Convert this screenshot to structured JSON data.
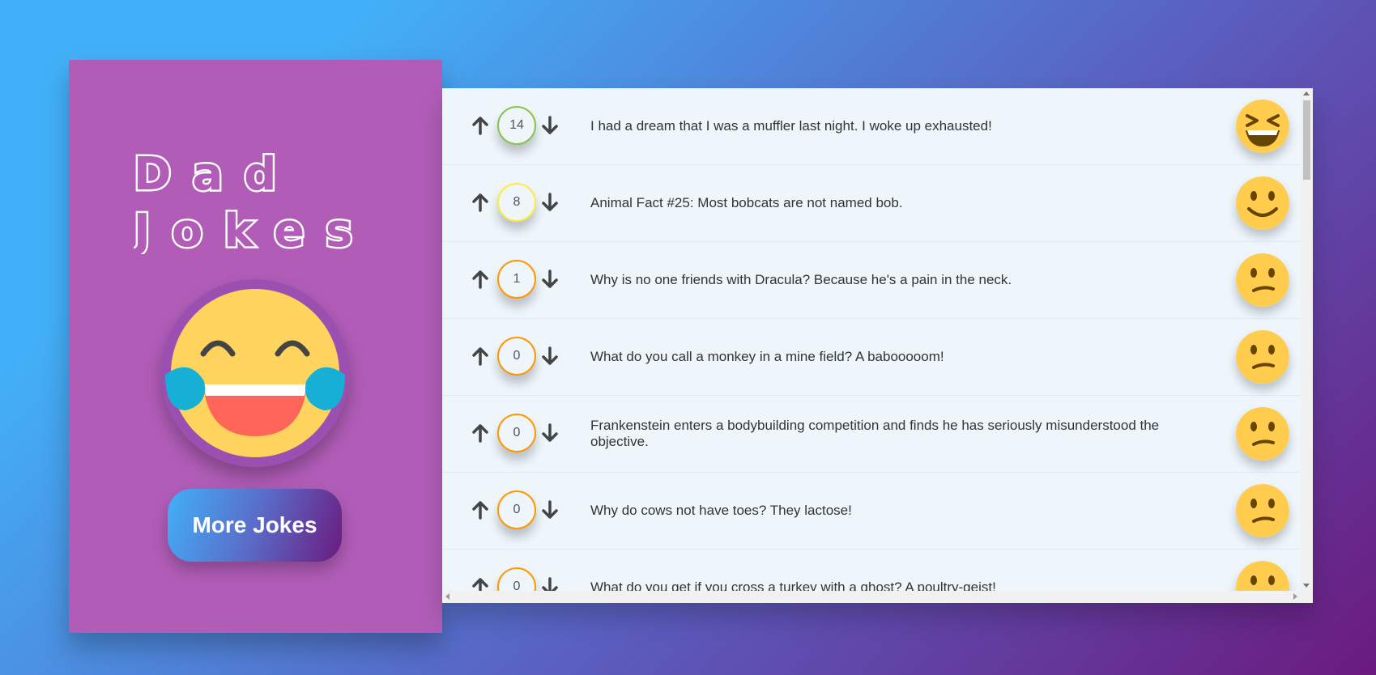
{
  "app": {
    "title_line1": "Dad",
    "title_line2": "Jokes",
    "hero_icon": "laughing-tears-emoji-icon",
    "more_button_label": "More Jokes"
  },
  "colors": {
    "sidebar": "#b15db8",
    "panel": "#eef6fc",
    "accent_gradient_start": "#42b0f8",
    "accent_gradient_end": "#6b1a7e",
    "vote_high": "#8bc34a",
    "vote_mid": "#ffeb3b",
    "vote_low": "#ff9800"
  },
  "jokes": [
    {
      "votes": "14",
      "text": "I had a dream that I was a muffler last night. I woke up exhausted!",
      "face": "laughing-face-icon",
      "ring": "#8bc34a"
    },
    {
      "votes": "8",
      "text": "Animal Fact #25: Most bobcats are not named bob.",
      "face": "smiling-face-icon",
      "ring": "#ffeb3b"
    },
    {
      "votes": "1",
      "text": "Why is no one friends with Dracula? Because he's a pain in the neck.",
      "face": "confused-face-icon",
      "ring": "#ff9800"
    },
    {
      "votes": "0",
      "text": "What do you call a monkey in a mine field? A babooooom!",
      "face": "confused-face-icon",
      "ring": "#ff9800"
    },
    {
      "votes": "0",
      "text": "Frankenstein enters a bodybuilding competition and finds he has seriously misunderstood the objective.",
      "face": "confused-face-icon",
      "ring": "#ff9800"
    },
    {
      "votes": "0",
      "text": "Why do cows not have toes? They lactose!",
      "face": "confused-face-icon",
      "ring": "#ff9800"
    },
    {
      "votes": "0",
      "text": "What do you get if you cross a turkey with a ghost? A poultry-geist!",
      "face": "confused-face-icon",
      "ring": "#ff9800"
    }
  ]
}
